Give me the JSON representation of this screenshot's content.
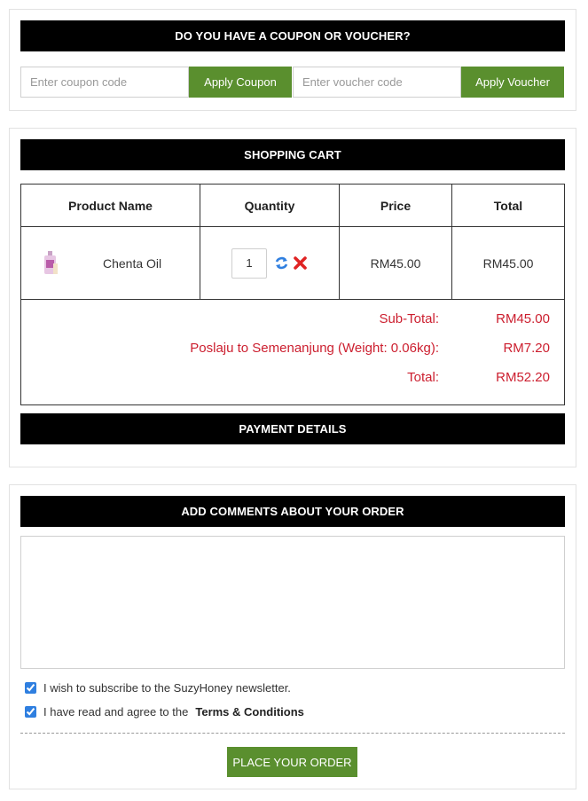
{
  "coupon_section": {
    "title": "DO YOU HAVE A COUPON OR VOUCHER?",
    "coupon_placeholder": "Enter coupon code",
    "coupon_button": "Apply Coupon",
    "voucher_placeholder": "Enter voucher code",
    "voucher_button": "Apply Voucher"
  },
  "cart": {
    "title": "SHOPPING CART",
    "headers": {
      "product": "Product Name",
      "quantity": "Quantity",
      "price": "Price",
      "total": "Total"
    },
    "items": [
      {
        "name": "Chenta Oil",
        "quantity": "1",
        "price": "RM45.00",
        "total": "RM45.00",
        "thumb_icon": "oil-bottle-thumbnail"
      }
    ],
    "update_icon": "refresh-icon",
    "remove_icon": "remove-icon",
    "totals": [
      {
        "label": "Sub-Total:",
        "value": "RM45.00"
      },
      {
        "label": "Poslaju to Semenanjung (Weight: 0.06kg):",
        "value": "RM7.20"
      },
      {
        "label": "Total:",
        "value": "RM52.20"
      }
    ],
    "totals_color": "#cc1f2f"
  },
  "payment": {
    "title": "PAYMENT DETAILS"
  },
  "comments": {
    "title": "ADD COMMENTS ABOUT YOUR ORDER",
    "value": "",
    "newsletter_label": "I wish to subscribe to the SuzyHoney newsletter.",
    "newsletter_checked": true,
    "terms_prefix": "I have read and agree to the",
    "terms_link": "Terms & Conditions",
    "terms_checked": true,
    "place_order_button": "PLACE YOUR ORDER"
  },
  "colors": {
    "accent_green": "#5a8f2e",
    "header_bar": "#000000",
    "checkbox_blue": "#2f7fe0"
  }
}
